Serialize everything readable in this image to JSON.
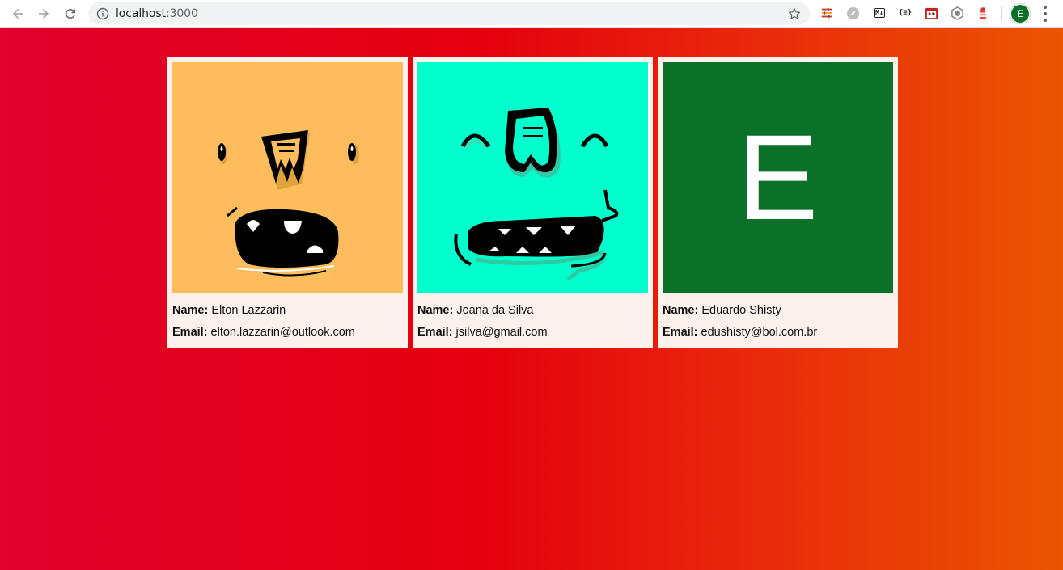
{
  "browser": {
    "url_host": "localhost",
    "url_port": ":3000",
    "profile_initial": "E",
    "extensions": [
      "sliders-icon",
      "compass-icon",
      "markdown-icon",
      "json-icon",
      "calendar-icon",
      "hexagon-icon",
      "lighthouse-icon"
    ],
    "extension_labels": {
      "markdown": "M↓",
      "json": "{≡}"
    }
  },
  "users": [
    {
      "avatar_type": "monster",
      "avatar_bg": "#fdbd5c",
      "name_label": "Name:",
      "name": "Elton Lazzarin",
      "email_label": "Email:",
      "email": "elton.lazzarin@outlook.com"
    },
    {
      "avatar_type": "monster",
      "avatar_bg": "#00ffcc",
      "name_label": "Name:",
      "name": "Joana da Silva",
      "email_label": "Email:",
      "email": "jsilva@gmail.com"
    },
    {
      "avatar_type": "letter",
      "avatar_bg": "#0b7128",
      "avatar_letter": "E",
      "name_label": "Name:",
      "name": "Eduardo Shisty",
      "email_label": "Email:",
      "email": "edushisty@bol.com.br"
    }
  ],
  "colors": {
    "page_gradient_start": "#e1002e",
    "page_gradient_end": "#ea5500",
    "card_bg": "#fdf1ec"
  }
}
